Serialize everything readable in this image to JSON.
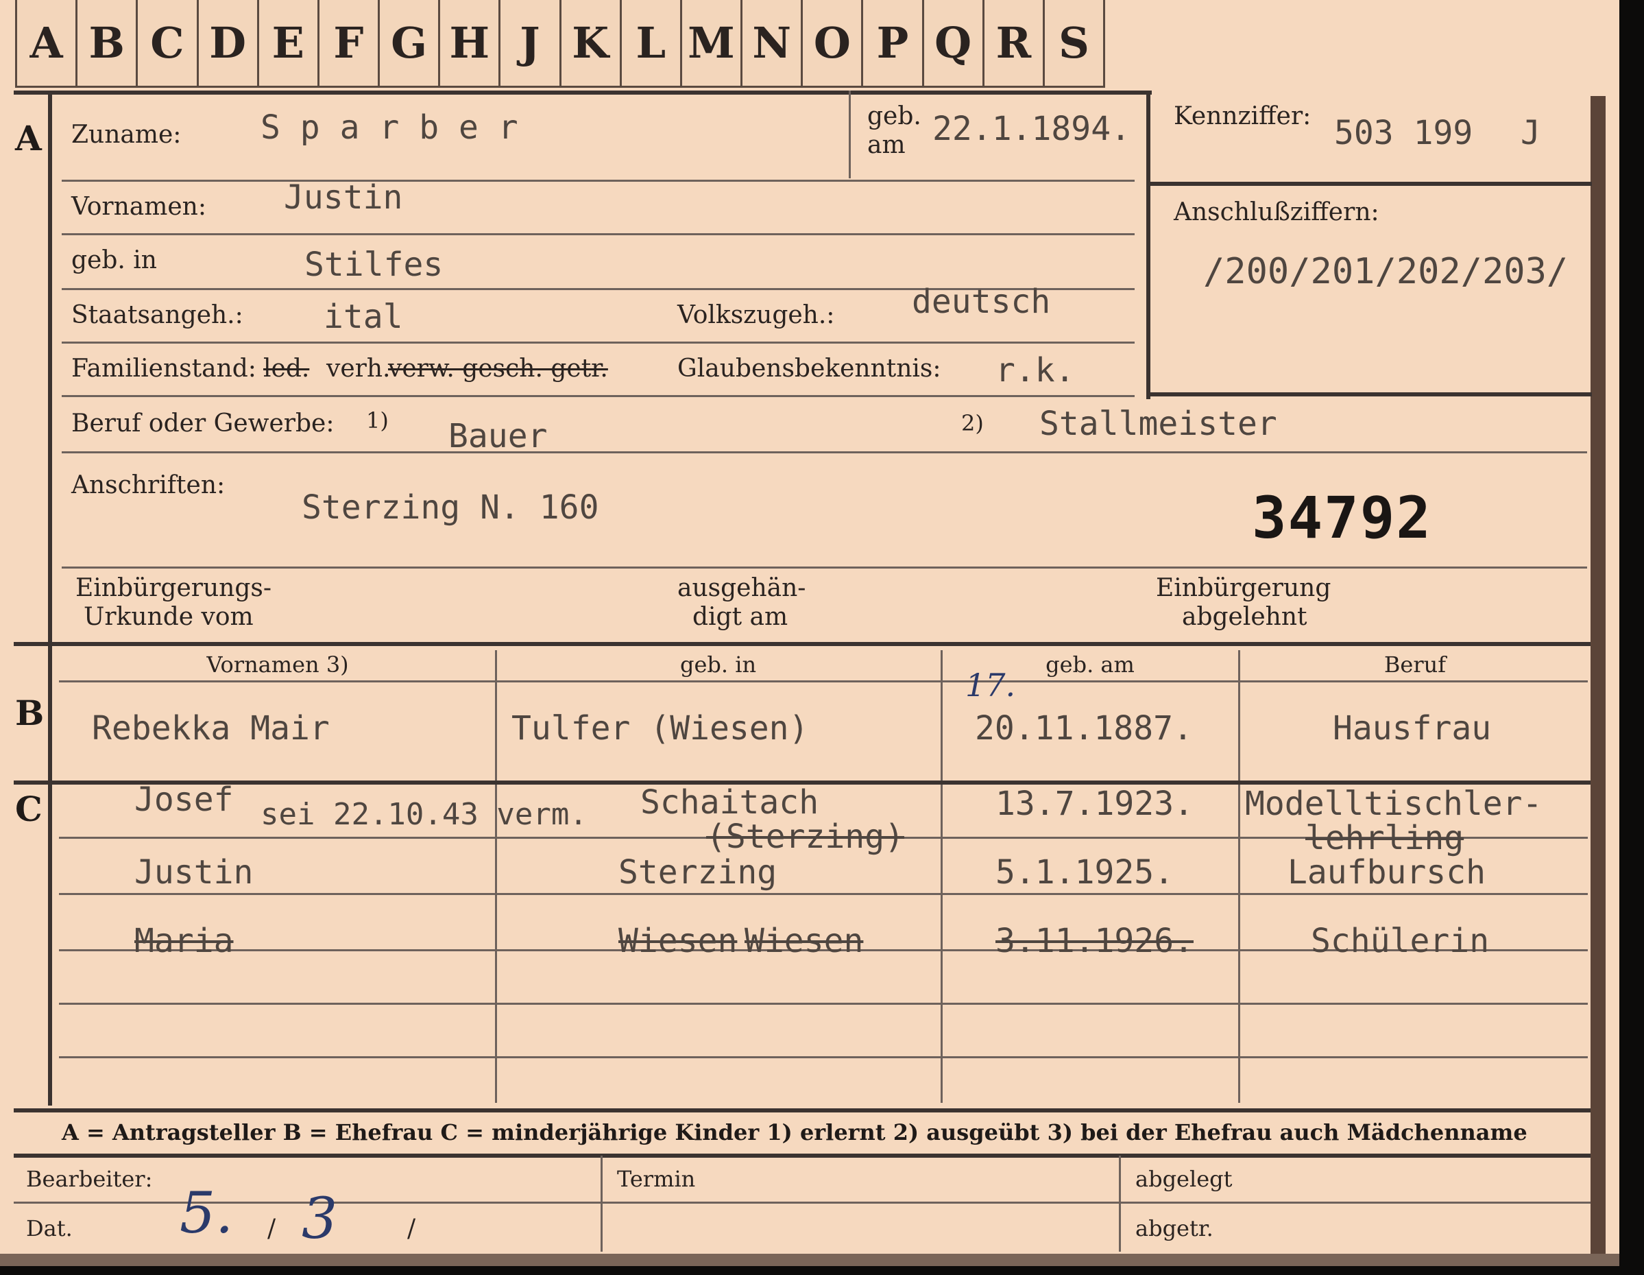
{
  "tabs": [
    "A",
    "B",
    "C",
    "D",
    "E",
    "F",
    "G",
    "H",
    "J",
    "K",
    "L",
    "M",
    "N",
    "O",
    "P",
    "Q",
    "R",
    "S"
  ],
  "section_a": {
    "marker": "A",
    "surname_label": "Zuname:",
    "surname": "S p a r b e r",
    "dob_label_1": "geb.",
    "dob_label_2": "am",
    "dob": "22.1.1894.",
    "kennziffer_label": "Kennziffer:",
    "kennziffer": "503 199",
    "kennziffer_suffix": "J",
    "anschluss_label": "Anschlußziffern:",
    "anschluss": "/200/201/202/203/",
    "vornamen_label": "Vornamen:",
    "vornamen": "Justin",
    "birthplace_label": "geb. in",
    "birthplace": "Stilfes",
    "citizenship_label": "Staatsangeh.:",
    "citizenship": "ital",
    "ethnicity_label": "Volkszugeh.:",
    "ethnicity": "deutsch",
    "marital_label": "Familienstand:",
    "marital_struck_1": "led.",
    "marital_value": "verh.",
    "marital_struck_2": "verw. gesch. getr.",
    "religion_label": "Glaubensbekenntnis:",
    "religion": "r.k.",
    "occupation_label": "Beruf oder Gewerbe:",
    "occ_note_1": "1)",
    "occupation_1": "Bauer",
    "occ_note_2": "2)",
    "occupation_2": "Stallmeister",
    "address_label": "Anschriften:",
    "address": "Sterzing N. 160",
    "stamp_number": "34792",
    "naturalisation_label_1": "Einbürgerungs-",
    "naturalisation_label_2": "Urkunde vom",
    "handed_label_1": "ausgehän-",
    "handed_label_2": "digt am",
    "refused_label_1": "Einbürgerung",
    "refused_label_2": "abgelehnt"
  },
  "section_b": {
    "marker": "B",
    "headers": [
      "Vornamen 3)",
      "geb. in",
      "geb. am",
      "Beruf"
    ],
    "wife": {
      "name": "Rebekka Mair",
      "place": "Tulfer (Wiesen)",
      "date_correction": "17.",
      "date": "20.11.1887.",
      "occupation": "Hausfrau"
    }
  },
  "section_c": {
    "marker": "C",
    "children": [
      {
        "name": "Josef",
        "note": "sei 22.10.43 verm.",
        "place": "Schaitach",
        "place_2": "(Sterzing)",
        "date": "13.7.1923.",
        "occupation": "Modelltischler-",
        "occupation_2": "lehrling"
      },
      {
        "name": "Justin",
        "place": "Sterzing",
        "date": "5.1.1925.",
        "occupation": "Laufbursch"
      },
      {
        "name": "Maria",
        "place_struck": "Wiesen",
        "place": "Wiesen",
        "date": "3.11.1926.",
        "occupation": "Schülerin"
      }
    ]
  },
  "legend": "A = Antragsteller   B = Ehefrau   C = minderjährige Kinder   1) erlernt   2) ausgeübt   3) bei der Ehefrau auch Mädchenname",
  "footer": {
    "bearbeiter_label": "Bearbeiter:",
    "datum_label": "Dat.",
    "datum_day": "5.",
    "datum_sep_1": "/",
    "datum_month": "3",
    "datum_sep_2": "/",
    "termin_label": "Termin",
    "abgelegt_label": "abgelegt",
    "abgetr_label": "abgetr."
  }
}
